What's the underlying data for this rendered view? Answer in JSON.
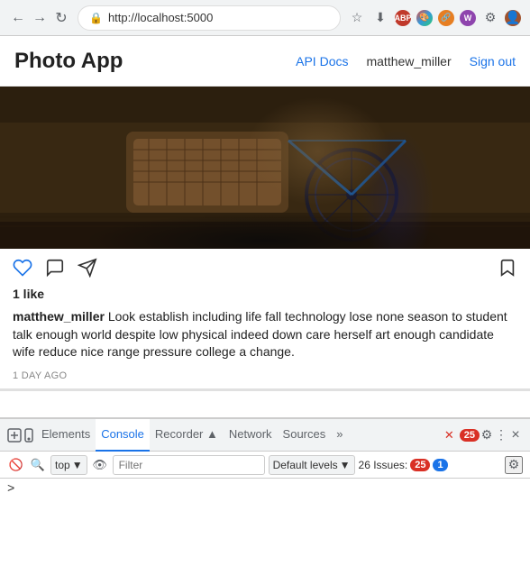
{
  "browser": {
    "url": "http://localhost:5000",
    "back_label": "←",
    "forward_label": "→",
    "reload_label": "↻",
    "extensions": [
      "ABP",
      "🎨",
      "🔗",
      "W",
      "⚙",
      "👤"
    ],
    "star_label": "☆",
    "download_label": "⬇"
  },
  "header": {
    "title": "Photo App",
    "nav": {
      "api_docs": "API Docs",
      "username": "matthew_miller",
      "signout": "Sign out"
    }
  },
  "post": {
    "likes": "1 like",
    "author": "matthew_miller",
    "caption": " Look establish including life fall technology lose none season to student talk enough world despite low physical indeed down care herself art enough candidate wife reduce nice range pressure college a change.",
    "timestamp": "1 DAY AGO"
  },
  "devtools": {
    "tabs": [
      {
        "label": "Elements",
        "active": false
      },
      {
        "label": "Console",
        "active": true
      },
      {
        "label": "Recorder ▲",
        "active": false
      },
      {
        "label": "Network",
        "active": false
      },
      {
        "label": "Sources",
        "active": false
      },
      {
        "label": "»",
        "active": false
      }
    ],
    "badge_count": "25",
    "toolbar": {
      "context": "top",
      "filter_placeholder": "Filter",
      "levels": "Default levels",
      "issues_label": "26 Issues:",
      "issues_red": "25",
      "issues_blue": "1"
    },
    "close_label": "×",
    "prompt_symbol": ">"
  }
}
